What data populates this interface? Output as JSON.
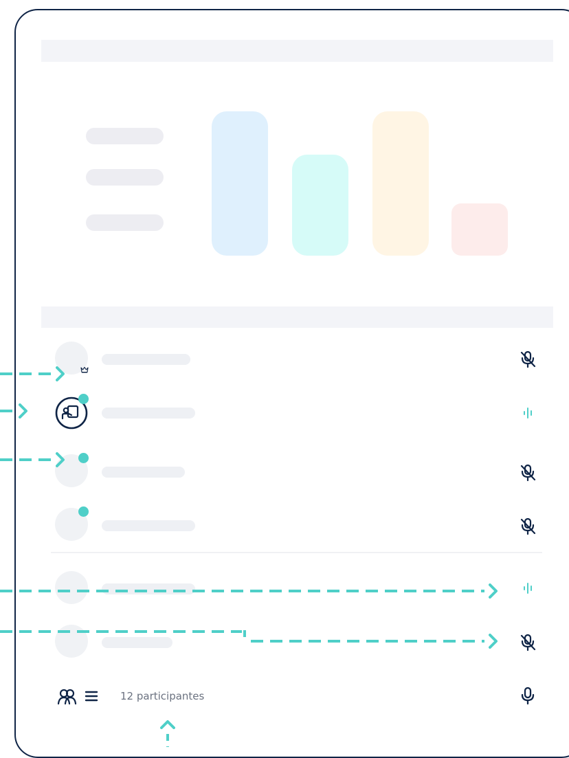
{
  "footer": {
    "participants_label": "12 participantes",
    "participants_icon": "participants-icon",
    "list_icon": "list-icon",
    "mic_icon": "microphone-icon"
  },
  "participants": [
    {
      "status_icon": "microphone-muted-icon",
      "badge": "crown-icon"
    },
    {
      "status_icon": "audio-waveform-icon",
      "badge": "presenter-icon",
      "online": true
    },
    {
      "status_icon": "microphone-muted-icon",
      "online": true
    },
    {
      "status_icon": "microphone-muted-icon",
      "online": true
    },
    {
      "status_icon": "audio-waveform-icon"
    },
    {
      "status_icon": "microphone-muted-icon"
    }
  ],
  "chart_data": {
    "type": "bar",
    "categories": [
      "",
      "",
      "",
      ""
    ],
    "values": [
      10,
      7,
      10,
      3.6
    ],
    "colors": [
      "#dff0fd",
      "#d6fbf8",
      "#fff5e4",
      "#fdeceb"
    ]
  },
  "colors": {
    "accent": "#4fcfc8",
    "frame": "#0f2446",
    "muted": "#9aa3b0"
  }
}
